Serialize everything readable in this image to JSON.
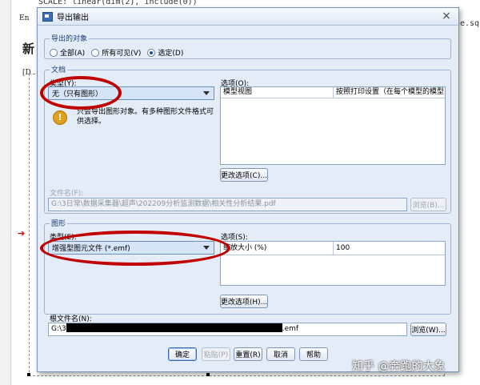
{
  "background": {
    "code_line": "SCALE: linear(dim(2), include(0))",
    "right_text": "e.sq",
    "left_char_1": "En",
    "left_char_2": "新",
    "left_char_3": "[D"
  },
  "dialog": {
    "title": "导出输出",
    "close_symbol": "×",
    "export_objects": {
      "label": "导出的对象",
      "options": [
        "全部(A)",
        "所有可见(V)",
        "选定(D)"
      ],
      "selected": "选定(D)"
    },
    "document": {
      "label": "文档",
      "type_label": "类型(Y):",
      "type_value": "无（只有图形）",
      "warning_icon": "warning-icon",
      "warning_text": "只会导出图形对象。有多种图形文件格式可供选择。",
      "options_label": "选项(O):",
      "options_table": [
        [
          "模型视图",
          "按照打印设置（在每个模型的模型..."
        ]
      ],
      "change_options": "更改选项(C)...",
      "filename_label": "文件名(F):",
      "filename_value": "G:\\3日常\\数据采集器\\超声\\202209分析监测数据\\相关性分析结果.pdf",
      "browse": "浏览(B)..."
    },
    "graphics": {
      "label": "图形",
      "type_label": "类型(E):",
      "type_value": "增强型图元文件 (*.emf)",
      "options_label": "选项(S):",
      "options_table": [
        [
          "缩放大小 (%)",
          "100"
        ]
      ],
      "change_options": "更改选项(H)...",
      "root_filename_label": "根文件名(N):",
      "root_filename_prefix": "G:\\3",
      "root_filename_suffix": ".emf",
      "browse": "浏览(W)..."
    },
    "buttons": {
      "ok": "确定",
      "paste": "粘贴(P)",
      "reset": "重置(R)",
      "cancel": "取消",
      "help": "帮助"
    }
  },
  "watermark": "知乎 @奔跑的大象",
  "colors": {
    "annotation": "#c00000",
    "dialog_bg": "#e3ecf7"
  }
}
